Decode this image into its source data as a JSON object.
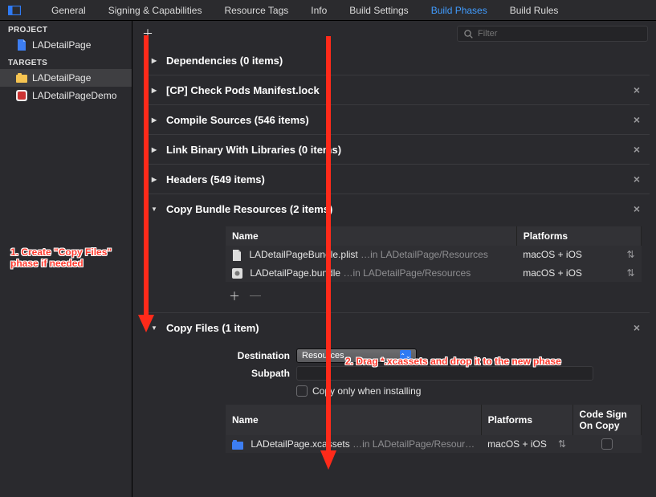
{
  "tabs": {
    "general": "General",
    "signing": "Signing & Capabilities",
    "resource_tags": "Resource Tags",
    "info": "Info",
    "build_settings": "Build Settings",
    "build_phases": "Build Phases",
    "build_rules": "Build Rules",
    "active": "Build Phases"
  },
  "sidebar": {
    "project_header": "PROJECT",
    "project_name": "LADetailPage",
    "targets_header": "TARGETS",
    "targets": [
      {
        "name": "LADetailPage",
        "selected": true
      },
      {
        "name": "LADetailPageDemo",
        "selected": false
      }
    ]
  },
  "search": {
    "placeholder": "Filter"
  },
  "phases": {
    "dependencies": {
      "label": "Dependencies (0 items)"
    },
    "check_pods": {
      "label": "[CP] Check Pods Manifest.lock"
    },
    "compile": {
      "label": "Compile Sources (546 items)"
    },
    "link": {
      "label": "Link Binary With Libraries (0 items)"
    },
    "headers": {
      "label": "Headers (549 items)"
    },
    "copy_bundle": {
      "label": "Copy Bundle Resources (2 items)",
      "columns": {
        "name": "Name",
        "platforms": "Platforms"
      },
      "rows": [
        {
          "file": "LADetailPageBundle.plist",
          "path": "…in LADetailPage/Resources",
          "plat": "macOS + iOS"
        },
        {
          "file": "LADetailPage.bundle",
          "path": "…in LADetailPage/Resources",
          "plat": "macOS + iOS"
        }
      ]
    },
    "copy_files": {
      "label": "Copy Files (1 item)",
      "destination_label": "Destination",
      "destination_value": "Resources",
      "subpath_label": "Subpath",
      "checkbox_label": "Copy only when installing",
      "columns": {
        "name": "Name",
        "platforms": "Platforms",
        "codesign": "Code Sign On Copy"
      },
      "rows": [
        {
          "file": "LADetailPage.xcassets",
          "path": "…in LADetailPage/Resour…",
          "plat": "macOS + iOS"
        }
      ]
    }
  },
  "annotations": {
    "a1": "1. Create \"Copy Files\" phase if needed",
    "a2": "2. Drag *.xcassets and drop it to the new phase"
  }
}
